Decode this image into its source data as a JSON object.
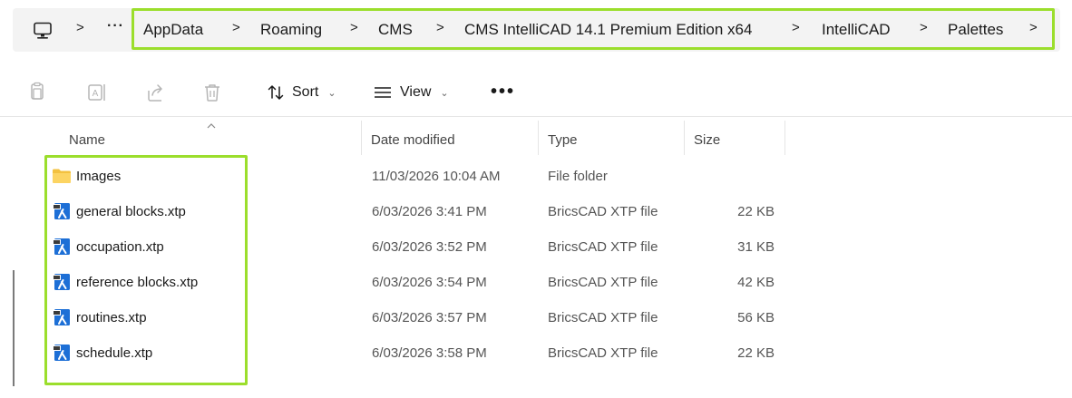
{
  "breadcrumb": {
    "overflow": "···",
    "separator": ">",
    "items": [
      "AppData",
      "Roaming",
      "CMS",
      "CMS IntelliCAD 14.1 Premium Edition x64",
      "IntelliCAD",
      "Palettes"
    ],
    "highlight_color": "#9bde2c"
  },
  "toolbar": {
    "sort_label": "Sort",
    "view_label": "View",
    "more_label": "•••",
    "icons": [
      "copy-icon",
      "rename-icon",
      "share-icon",
      "delete-icon",
      "sort-icon",
      "view-icon"
    ]
  },
  "columns": {
    "name": "Name",
    "date": "Date modified",
    "type": "Type",
    "size": "Size"
  },
  "files": [
    {
      "name": "Images",
      "date": "11/03/2026 10:04 AM",
      "type": "File folder",
      "size": "",
      "icon": "folder-icon"
    },
    {
      "name": "general blocks.xtp",
      "date": "6/03/2026 3:41 PM",
      "type": "BricsCAD XTP file",
      "size": "22 KB",
      "icon": "xtp-file-icon"
    },
    {
      "name": "occupation.xtp",
      "date": "6/03/2026 3:52 PM",
      "type": "BricsCAD XTP file",
      "size": "31 KB",
      "icon": "xtp-file-icon"
    },
    {
      "name": "reference blocks.xtp",
      "date": "6/03/2026 3:54 PM",
      "type": "BricsCAD XTP file",
      "size": "42 KB",
      "icon": "xtp-file-icon"
    },
    {
      "name": "routines.xtp",
      "date": "6/03/2026 3:57 PM",
      "type": "BricsCAD XTP file",
      "size": "56 KB",
      "icon": "xtp-file-icon"
    },
    {
      "name": "schedule.xtp",
      "date": "6/03/2026 3:58 PM",
      "type": "BricsCAD XTP file",
      "size": "22 KB",
      "icon": "xtp-file-icon"
    }
  ]
}
